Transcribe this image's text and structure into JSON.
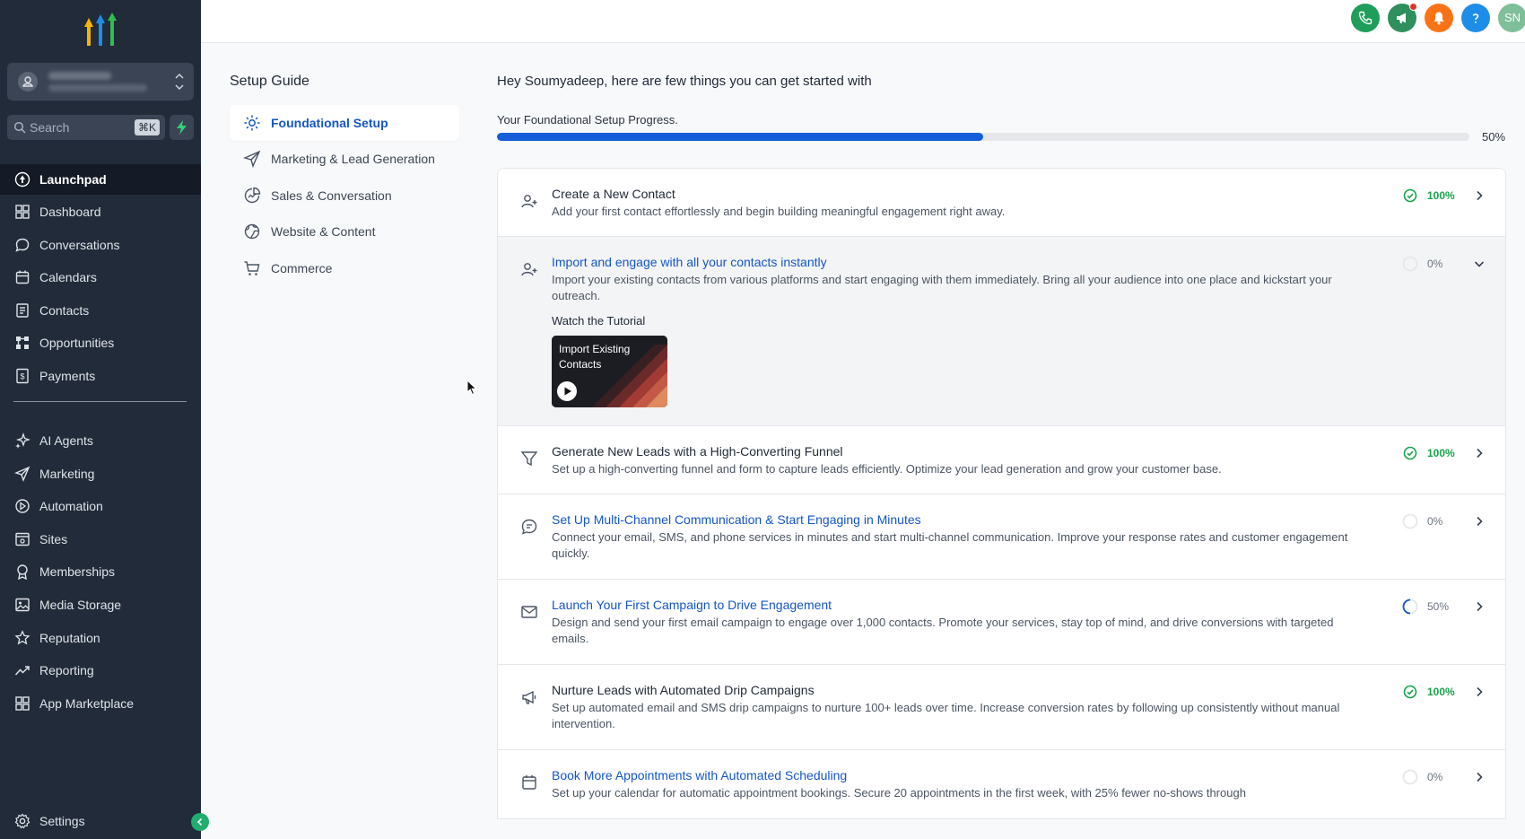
{
  "sidebar": {
    "search_placeholder": "Search",
    "search_shortcut": "⌘K",
    "items": [
      {
        "label": "Launchpad",
        "icon": "launchpad-icon",
        "active": true
      },
      {
        "label": "Dashboard",
        "icon": "dashboard-icon"
      },
      {
        "label": "Conversations",
        "icon": "chat-icon"
      },
      {
        "label": "Calendars",
        "icon": "calendar-icon"
      },
      {
        "label": "Contacts",
        "icon": "contacts-icon"
      },
      {
        "label": "Opportunities",
        "icon": "opportunities-icon"
      },
      {
        "label": "Payments",
        "icon": "payments-icon"
      },
      {
        "label": "AI Agents",
        "icon": "sparkle-icon"
      },
      {
        "label": "Marketing",
        "icon": "send-icon"
      },
      {
        "label": "Automation",
        "icon": "automation-icon"
      },
      {
        "label": "Sites",
        "icon": "sites-icon"
      },
      {
        "label": "Memberships",
        "icon": "award-icon"
      },
      {
        "label": "Media Storage",
        "icon": "image-icon"
      },
      {
        "label": "Reputation",
        "icon": "star-icon"
      },
      {
        "label": "Reporting",
        "icon": "trend-icon"
      },
      {
        "label": "App Marketplace",
        "icon": "grid-icon"
      }
    ],
    "settings_label": "Settings"
  },
  "topbar": {
    "buttons": [
      {
        "name": "phone",
        "color": "#1e9e5a"
      },
      {
        "name": "announcements",
        "color": "#2f8f5d"
      },
      {
        "name": "notifications",
        "color": "#f97316"
      },
      {
        "name": "help",
        "color": "#1d8de8"
      },
      {
        "name": "user",
        "color": "#7fbf9a"
      }
    ],
    "user_initials": "SN"
  },
  "guide": {
    "title": "Setup Guide",
    "items": [
      {
        "label": "Foundational Setup",
        "active": true
      },
      {
        "label": "Marketing & Lead Generation"
      },
      {
        "label": "Sales & Conversation"
      },
      {
        "label": "Website & Content"
      },
      {
        "label": "Commerce"
      }
    ]
  },
  "main": {
    "greeting": "Hey Soumyadeep, here are few things you can get started with",
    "progress_label": "Your Foundational Setup Progress.",
    "progress_value": 50,
    "progress_text": "50%",
    "tutorial_label": "Watch the Tutorial",
    "video_title": "Import Existing Contacts",
    "tasks": [
      {
        "title": "Create a New Contact",
        "desc": "Add your first contact effortlessly and begin building meaningful engagement right away.",
        "progress": 100,
        "progress_text": "100%",
        "link": false
      },
      {
        "title": "Import and engage with all your contacts instantly",
        "desc": "Import your existing contacts from various platforms and start engaging with them immediately. Bring all your audience into one place and kickstart your outreach.",
        "progress": 0,
        "progress_text": "0%",
        "link": true,
        "expanded": true
      },
      {
        "title": "Generate New Leads with a High-Converting Funnel",
        "desc": "Set up a high-converting funnel and form to capture leads efficiently. Optimize your lead generation and grow your customer base.",
        "progress": 100,
        "progress_text": "100%",
        "link": false
      },
      {
        "title": "Set Up Multi-Channel Communication & Start Engaging in Minutes",
        "desc": "Connect your email, SMS, and phone services in minutes and start multi-channel communication. Improve your response rates and customer engagement quickly.",
        "progress": 0,
        "progress_text": "0%",
        "link": true
      },
      {
        "title": "Launch Your First Campaign to Drive Engagement",
        "desc": "Design and send your first email campaign to engage over 1,000 contacts. Promote your services, stay top of mind, and drive conversions with targeted emails.",
        "progress": 50,
        "progress_text": "50%",
        "link": true
      },
      {
        "title": "Nurture Leads with Automated Drip Campaigns",
        "desc": "Set up automated email and SMS drip campaigns to nurture 100+ leads over time. Increase conversion rates by following up consistently without manual intervention.",
        "progress": 100,
        "progress_text": "100%",
        "link": false
      },
      {
        "title": "Book More Appointments with Automated Scheduling",
        "desc": "Set up your calendar for automatic appointment bookings. Secure 20 appointments in the first week, with 25% fewer no-shows through",
        "progress": 0,
        "progress_text": "0%",
        "link": true
      }
    ]
  }
}
